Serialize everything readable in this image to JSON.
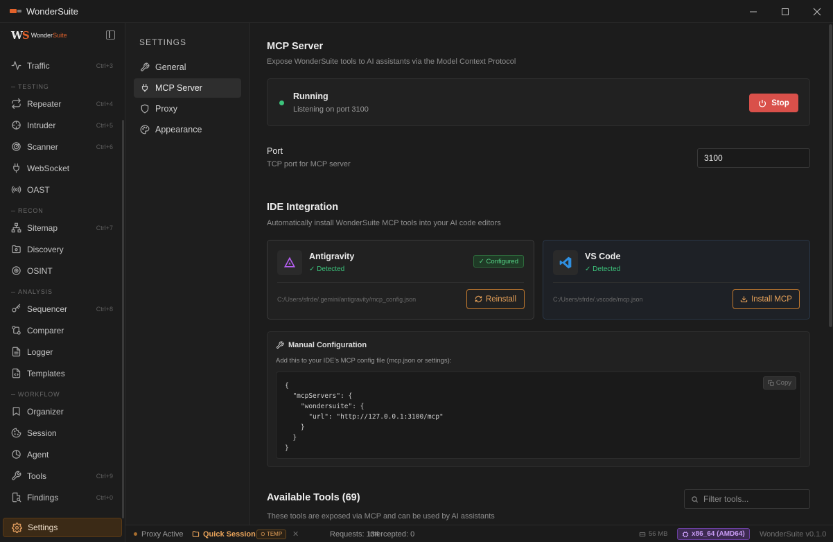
{
  "window": {
    "title": "WonderSuite"
  },
  "sidebar": {
    "logo_ws": "WS",
    "logo_brand_1": "Wonder",
    "logo_brand_2": "Suite",
    "items": [
      {
        "label": "Traffic",
        "shortcut": "Ctrl+3",
        "icon": "activity-icon"
      },
      {
        "group": "TESTING"
      },
      {
        "label": "Repeater",
        "shortcut": "Ctrl+4",
        "icon": "repeat-icon"
      },
      {
        "label": "Intruder",
        "shortcut": "Ctrl+5",
        "icon": "crosshair-icon"
      },
      {
        "label": "Scanner",
        "shortcut": "Ctrl+6",
        "icon": "radar-icon"
      },
      {
        "label": "WebSocket",
        "shortcut": "",
        "icon": "plug-icon"
      },
      {
        "label": "OAST",
        "shortcut": "",
        "icon": "radio-icon"
      },
      {
        "group": "RECON"
      },
      {
        "label": "Sitemap",
        "shortcut": "Ctrl+7",
        "icon": "sitemap-icon"
      },
      {
        "label": "Discovery",
        "shortcut": "",
        "icon": "folder-search-icon"
      },
      {
        "label": "OSINT",
        "shortcut": "",
        "icon": "eye-icon"
      },
      {
        "group": "ANALYSIS"
      },
      {
        "label": "Sequencer",
        "shortcut": "Ctrl+8",
        "icon": "key-icon"
      },
      {
        "label": "Comparer",
        "shortcut": "",
        "icon": "compare-icon"
      },
      {
        "label": "Logger",
        "shortcut": "",
        "icon": "file-text-icon"
      },
      {
        "label": "Templates",
        "shortcut": "",
        "icon": "file-code-icon"
      },
      {
        "group": "WORKFLOW"
      },
      {
        "label": "Organizer",
        "shortcut": "",
        "icon": "bookmark-icon"
      },
      {
        "label": "Session",
        "shortcut": "",
        "icon": "cookie-icon"
      },
      {
        "label": "Agent",
        "shortcut": "",
        "icon": "bot-icon"
      },
      {
        "label": "Tools",
        "shortcut": "Ctrl+9",
        "icon": "wrench-icon"
      },
      {
        "label": "Findings",
        "shortcut": "Ctrl+0",
        "icon": "search-file-icon"
      }
    ],
    "settings_label": "Settings"
  },
  "settings_menu": {
    "heading": "SETTINGS",
    "items": [
      {
        "label": "General",
        "icon": "wrench-icon"
      },
      {
        "label": "MCP Server",
        "icon": "plug-icon",
        "active": true
      },
      {
        "label": "Proxy",
        "icon": "shield-icon"
      },
      {
        "label": "Appearance",
        "icon": "palette-icon"
      }
    ]
  },
  "main": {
    "title": "MCP Server",
    "subtitle": "Expose WonderSuite tools to AI assistants via the Model Context Protocol",
    "status": {
      "title": "Running",
      "subtitle": "Listening on port 3100",
      "button": "Stop",
      "color": "#3cc47c"
    },
    "port": {
      "label": "Port",
      "description": "TCP port for MCP server",
      "value": "3100"
    },
    "ide": {
      "title": "IDE Integration",
      "subtitle": "Automatically install WonderSuite MCP tools into your AI code editors",
      "cards": [
        {
          "name": "Antigravity",
          "detected": "Detected",
          "badge": "Configured",
          "path": "C:/Users/sfrde/.gemini/antigravity/mcp_config.json",
          "button": "Reinstall"
        },
        {
          "name": "VS Code",
          "detected": "Detected",
          "path": "C:/Users/sfrde/.vscode/mcp.json",
          "button": "Install MCP"
        }
      ]
    },
    "manual": {
      "title": "Manual Configuration",
      "subtitle": "Add this to your IDE's MCP config file (mcp.json or settings):",
      "code": "{\n  \"mcpServers\": {\n    \"wondersuite\": {\n      \"url\": \"http://127.0.0.1:3100/mcp\"\n    }\n  }\n}",
      "copy": "Copy"
    },
    "tools": {
      "title": "Available Tools (69)",
      "subtitle": "These tools are exposed via MCP and can be used by AI assistants",
      "filter_placeholder": "Filter tools..."
    }
  },
  "statusbar": {
    "proxy": "Proxy Active",
    "session": "Quick Session",
    "temp": "TEMP",
    "requests": "Requests: 134",
    "intercepted": "Intercepted: 0",
    "memory": "56 MB",
    "arch": "x86_64 (AMD64)",
    "version": "WonderSuite v0.1.0"
  },
  "colors": {
    "accent": "#e2622b",
    "orange_button": "#c37a2f",
    "stop": "#d9504a",
    "running": "#3cc47c",
    "arch_badge": "#6a3fa0"
  }
}
